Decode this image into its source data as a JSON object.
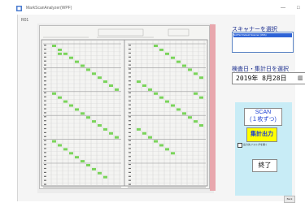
{
  "window": {
    "title": "MarkScanAnalyzer(WPF)",
    "min_glyph": "—",
    "max_glyph": "□"
  },
  "menu": {
    "label": "R01"
  },
  "scanner": {
    "label": "スキャナーを選択",
    "selected": "NAPS2 Default Scanner (WIA)"
  },
  "date": {
    "label": "検査日・集計日を選択",
    "value": "2019年 8月28日",
    "dropdown_icon": "calendar-dropdown-icon"
  },
  "actions": {
    "scan_line1": "SCAN",
    "scan_line2": "(１枚ずつ)",
    "stat_label": "集計出力",
    "stat_checkbox": "出力先フォルダを開く",
    "end_label": "終了"
  },
  "corner_button": "Back",
  "colors": {
    "accent_blue": "#1c3fd2",
    "panel_bg": "#c8ecf6",
    "highlight_yellow": "#ffff00",
    "mark_green": "#7ad45a"
  }
}
